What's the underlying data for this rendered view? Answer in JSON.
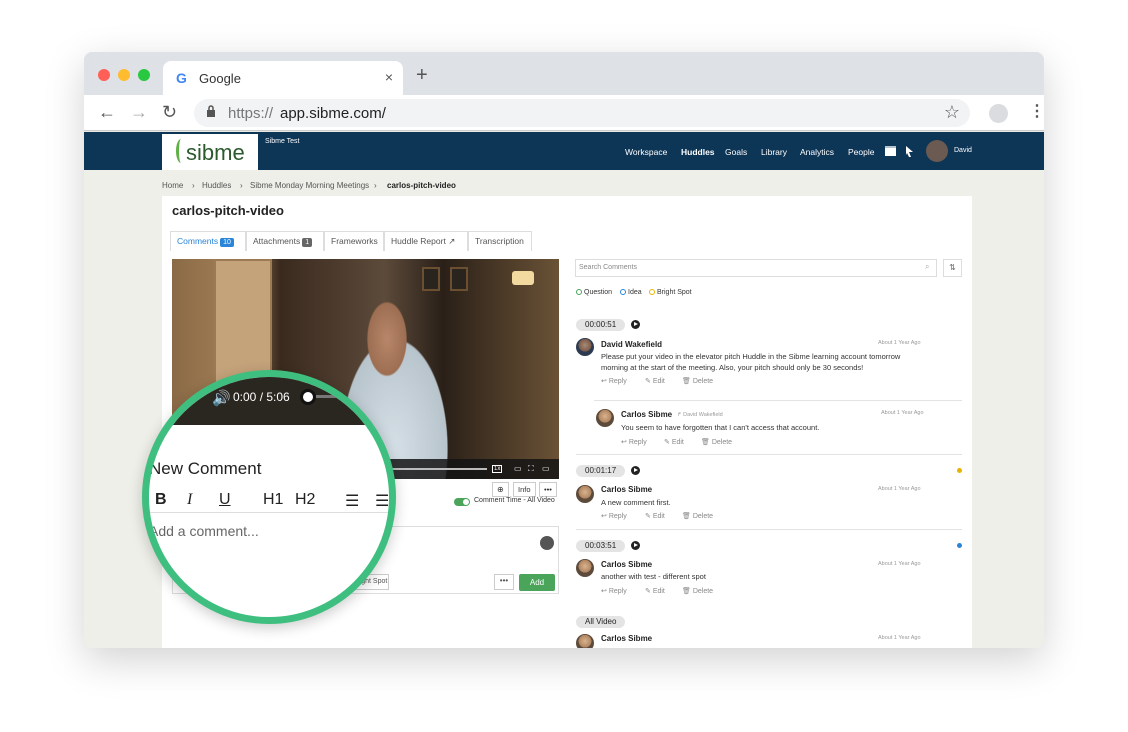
{
  "browser": {
    "tab_title": "Google",
    "tab_close": "×",
    "new_tab": "+",
    "url_protocol": "https://",
    "url_host": "app.sibme.com/",
    "back": "←",
    "forward": "→",
    "reload": "↻",
    "bookmark": "☆",
    "menu": "⋮"
  },
  "header": {
    "logo": "sibme",
    "account": "Sibme Test",
    "nav": [
      "Workspace",
      "Huddles",
      "Goals",
      "Library",
      "Analytics",
      "People"
    ],
    "user": "David"
  },
  "breadcrumb": [
    "Home",
    "Huddles",
    "Sibme Monday Morning Meetings",
    "carlos-pitch-video"
  ],
  "page_title": "carlos-pitch-video",
  "tabs": {
    "comments": "Comments",
    "comments_count": "10",
    "attachments": "Attachments",
    "attachments_count": "1",
    "frameworks": "Frameworks",
    "huddle_report": "Huddle Report",
    "transcription": "Transcription"
  },
  "video": {
    "speed": "1x",
    "info": "Info",
    "more": "•••",
    "comment_time": "Comment Time - All Video"
  },
  "composer": {
    "bright_spot": "Bright Spot",
    "more": "•••",
    "add": "Add"
  },
  "magnifier": {
    "time": "0:00  /  5:06",
    "title": "New Comment",
    "placeholder": "Add a comment...",
    "tools": [
      "B",
      "I",
      "U",
      "H1",
      "H2"
    ]
  },
  "search_placeholder": "Search Comments",
  "legend": [
    "Question",
    "Idea",
    "Bright Spot"
  ],
  "colors": {
    "question": "#4aa55a",
    "idea": "#2a84d8",
    "bright_spot": "#e6b400",
    "header": "#0d3556",
    "accent": "#3fbf7f"
  },
  "comments": [
    {
      "time": "00:00:51",
      "author": "David Wakefield",
      "ago": "About 1 Year Ago",
      "text1": "Please put your video in the elevator pitch Huddle in the Sibme learning account tomorrow",
      "text2": "morning at the start of the meeting.  Also, your pitch should only be 30 seconds!",
      "reply": {
        "author": "Carlos Sibme",
        "to": "↱ David Wakefield",
        "ago": "About 1 Year Ago",
        "text": "You seem to have forgotten that I can't access that account."
      }
    },
    {
      "time": "00:01:17",
      "author": "Carlos Sibme",
      "ago": "About 1 Year Ago",
      "text": "A new comment first."
    },
    {
      "time": "00:03:51",
      "author": "Carlos Sibme",
      "ago": "About 1 Year Ago",
      "text": "another with test - different spot"
    }
  ],
  "actions": {
    "reply": "Reply",
    "edit": "Edit",
    "delete": "Delete"
  },
  "all_video": "All Video",
  "last_author": "Carlos Sibme",
  "last_ago": "About 1 Year Ago"
}
